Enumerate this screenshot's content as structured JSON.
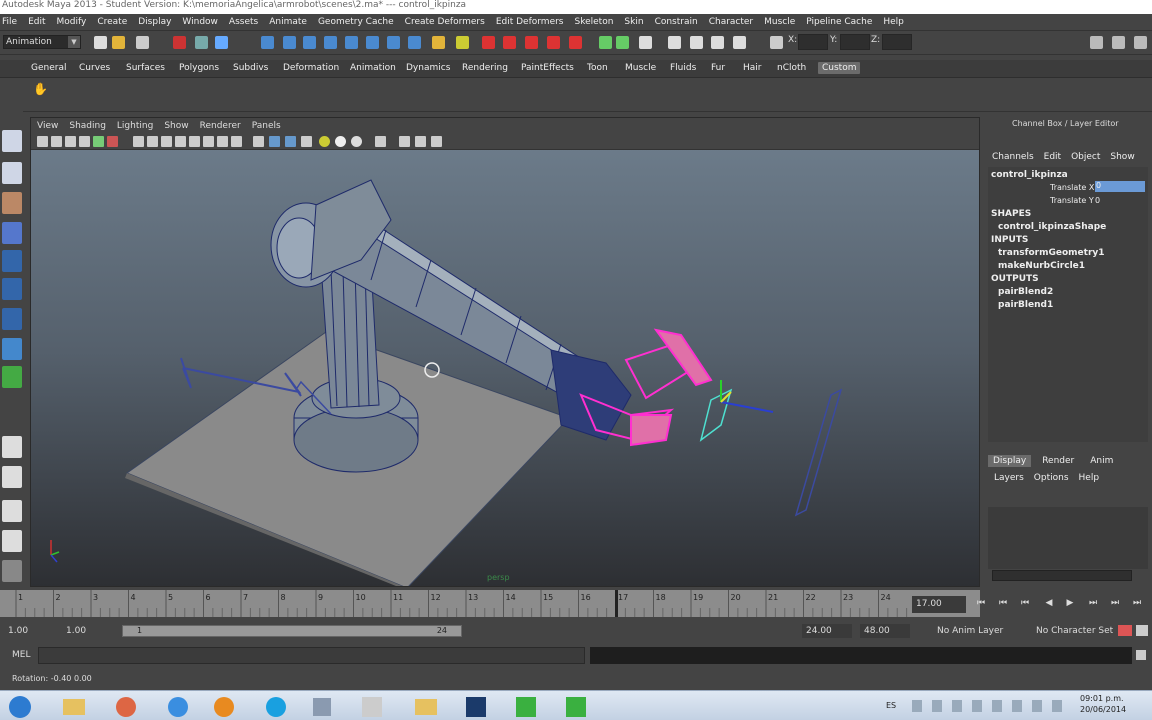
{
  "window": {
    "title": "Autodesk Maya 2013 - Student Version: K:\\memoriaAngelica\\armrobot\\scenes\\2.ma*  ---  control_ikpinza"
  },
  "menus": [
    "File",
    "Edit",
    "Modify",
    "Create",
    "Display",
    "Window",
    "Assets",
    "Animate",
    "Geometry Cache",
    "Create Deformers",
    "Edit Deformers",
    "Skeleton",
    "Skin",
    "Constrain",
    "Character",
    "Muscle",
    "Pipeline Cache",
    "Help"
  ],
  "status": {
    "mode": "Animation",
    "x_label": "X:",
    "y_label": "Y:",
    "z_label": "Z:"
  },
  "shelf_tabs": [
    "General",
    "Curves",
    "Surfaces",
    "Polygons",
    "Subdivs",
    "Deformation",
    "Animation",
    "Dynamics",
    "Rendering",
    "PaintEffects",
    "Toon",
    "Muscle",
    "Fluids",
    "Fur",
    "Hair",
    "nCloth",
    "Custom"
  ],
  "active_shelf": "Custom",
  "viewport": {
    "menus": [
      "View",
      "Shading",
      "Lighting",
      "Show",
      "Renderer",
      "Panels"
    ],
    "camera_label": "persp"
  },
  "channel_box": {
    "title": "Channel Box / Layer Editor",
    "menus": [
      "Channels",
      "Edit",
      "Object",
      "Show"
    ],
    "object": "control_ikpinza",
    "attrs": [
      {
        "name": "Translate X",
        "value": "0"
      },
      {
        "name": "Translate Y",
        "value": "0"
      }
    ],
    "shapes_header": "SHAPES",
    "shape": "control_ikpinzaShape",
    "inputs_header": "INPUTS",
    "inputs": [
      "transformGeometry1",
      "makeNurbCircle1"
    ],
    "outputs_header": "OUTPUTS",
    "outputs": [
      "pairBlend2",
      "pairBlend1"
    ]
  },
  "layer_editor": {
    "tabs": [
      "Display",
      "Render",
      "Anim"
    ],
    "active": "Display",
    "menus": [
      "Layers",
      "Options",
      "Help"
    ]
  },
  "timeline": {
    "ticks": [
      "1",
      "2",
      "3",
      "4",
      "5",
      "6",
      "7",
      "8",
      "9",
      "10",
      "11",
      "12",
      "13",
      "14",
      "15",
      "16",
      "17",
      "18",
      "19",
      "20",
      "21",
      "22",
      "23",
      "24"
    ],
    "current_frame": "17.00",
    "current": 17
  },
  "range": {
    "start": "1.00",
    "playback_start": "1.00",
    "slider_start": "1",
    "slider_end": "24",
    "playback_end": "24.00",
    "end": "48.00",
    "anim_layer": "No Anim Layer",
    "character_set": "No Character Set"
  },
  "cmd": {
    "label": "MEL"
  },
  "help": {
    "text": "Rotation: -0.40   0.00"
  },
  "taskbar": {
    "lang": "ES",
    "time": "09:01 p.m.",
    "date": "20/06/2014"
  },
  "colors": {
    "selection": "#ff2fd0",
    "panel": "#444444",
    "viewport_top": "#6f7f8e",
    "viewport_bottom": "#2d2f33"
  }
}
